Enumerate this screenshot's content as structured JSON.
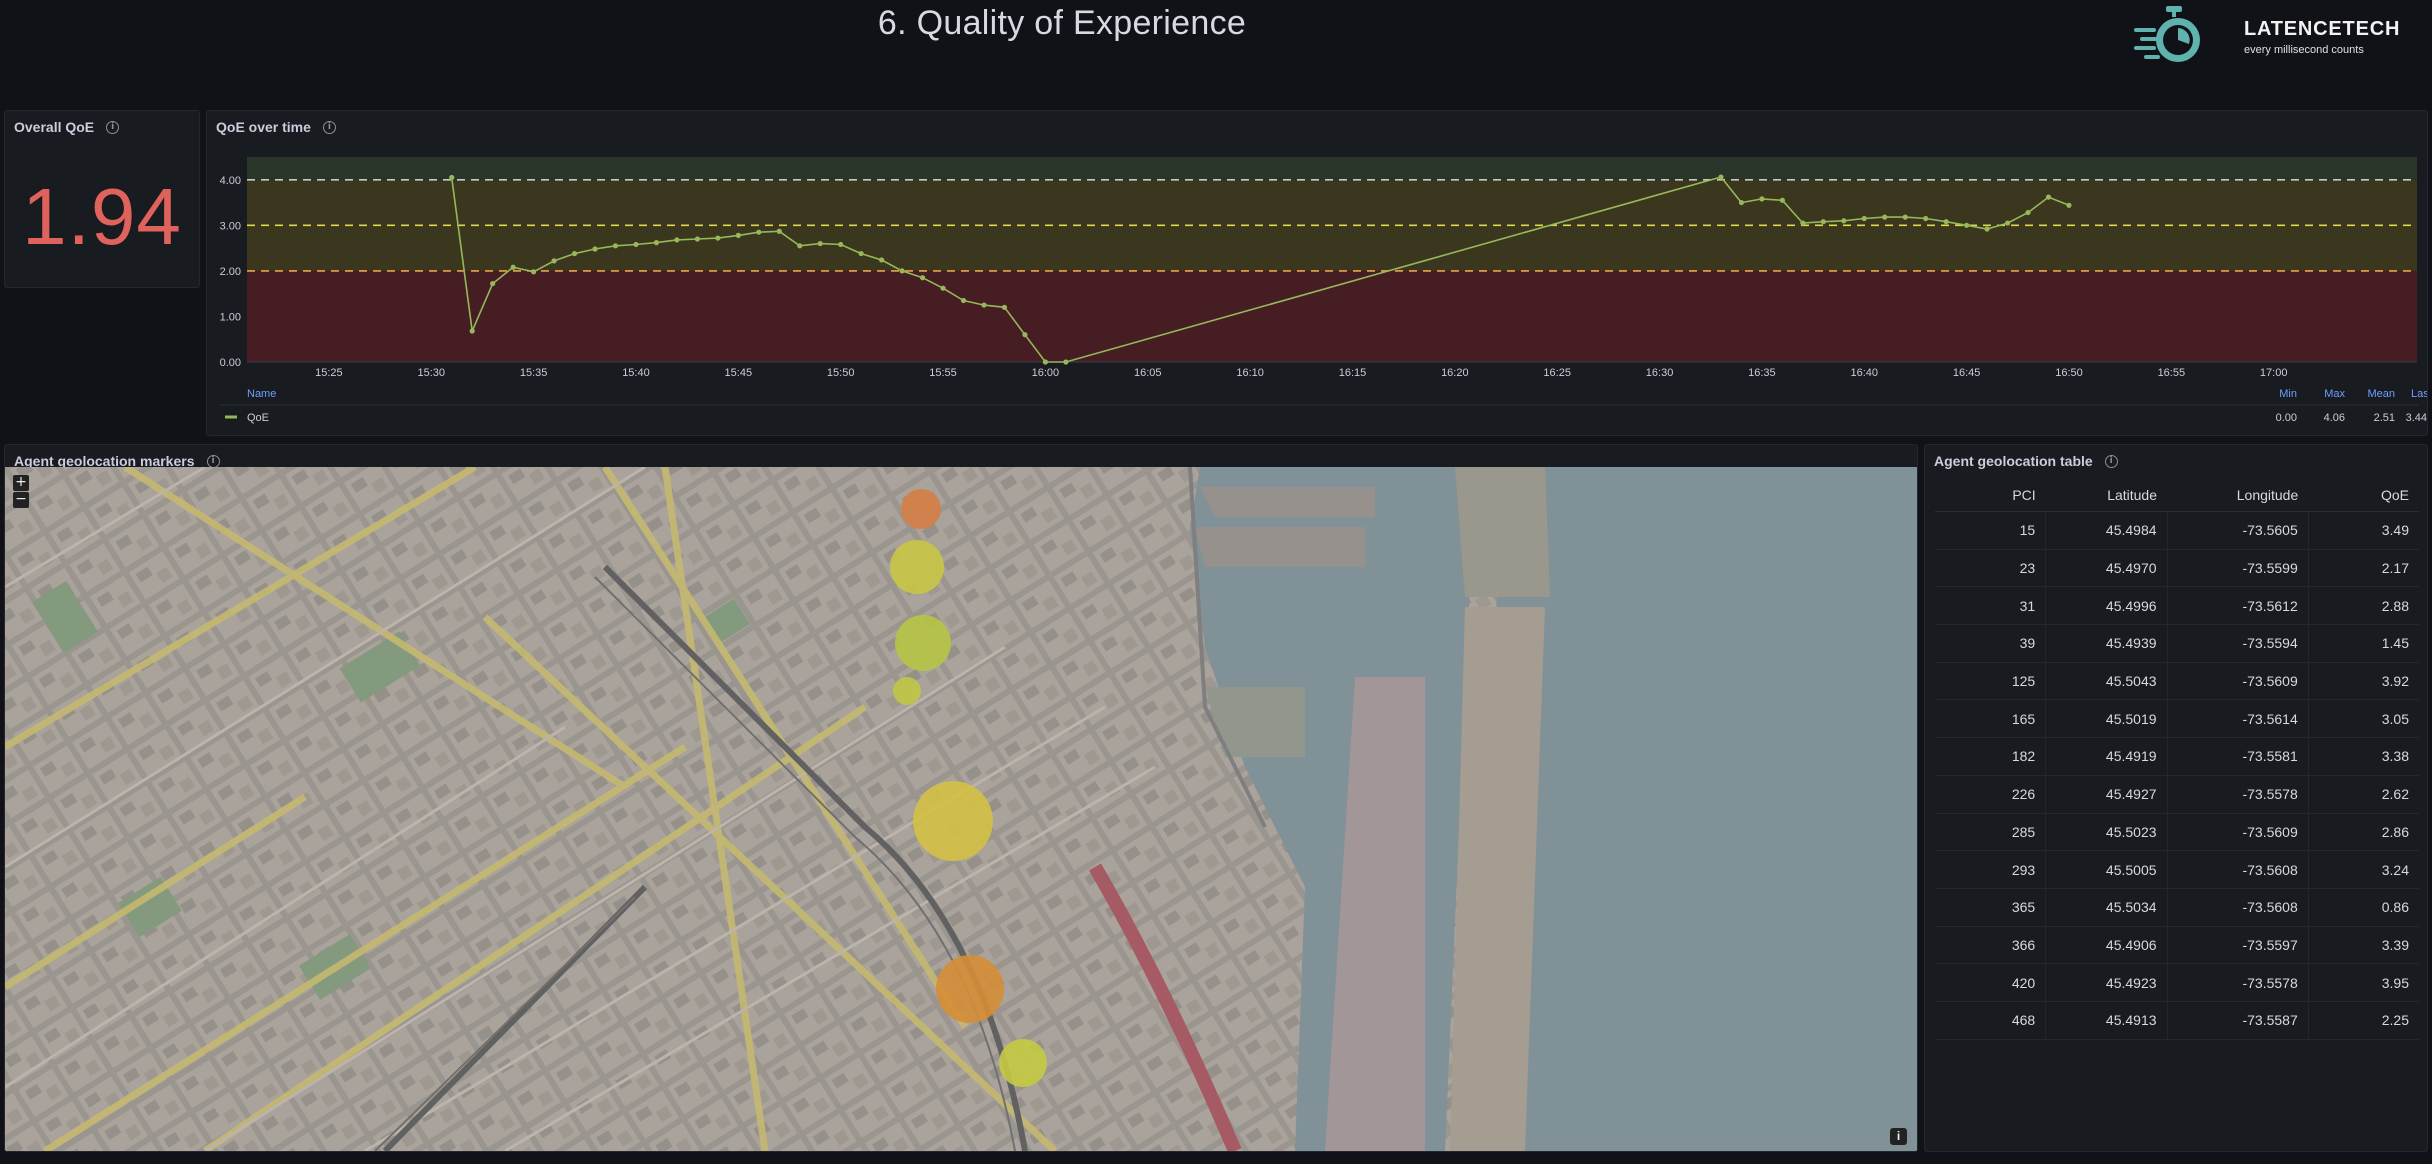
{
  "page": {
    "title": "6. Quality of Experience"
  },
  "logo": {
    "name": "LATENCETECH",
    "tagline": "every millisecond counts"
  },
  "overall_qoe": {
    "title": "Overall QoE",
    "value": "1.94",
    "color": "#e0625c"
  },
  "qoe_over_time": {
    "title": "QoE over time",
    "legend": {
      "name_header": "Name",
      "series_name": "QoE",
      "headers": {
        "min": "Min",
        "max": "Max",
        "mean": "Mean",
        "last": "Last"
      },
      "values": {
        "min": "0.00",
        "max": "4.06",
        "mean": "2.51",
        "last": "3.44"
      }
    },
    "thresholds": [
      {
        "value": 2,
        "color": "#e8a44a"
      },
      {
        "value": 3,
        "color": "#e0d84a"
      },
      {
        "value": 4,
        "color": "#c8c8c8"
      }
    ]
  },
  "chart_data": {
    "type": "line",
    "title": "QoE over time",
    "xlabel": "",
    "ylabel": "",
    "ylim": [
      0,
      4.5
    ],
    "xlim": [
      "15:21",
      "17:07"
    ],
    "y_ticks": [
      "0.00",
      "1.00",
      "2.00",
      "3.00",
      "4.00"
    ],
    "x_ticks": [
      "15:25",
      "15:30",
      "15:35",
      "15:40",
      "15:45",
      "15:50",
      "15:55",
      "16:00",
      "16:05",
      "16:10",
      "16:15",
      "16:20",
      "16:25",
      "16:30",
      "16:35",
      "16:40",
      "16:45",
      "16:50",
      "16:55",
      "17:00"
    ],
    "grid": false,
    "legend": "bottom",
    "bands": [
      {
        "from": 0,
        "to": 2,
        "color": "#4a1e24"
      },
      {
        "from": 2,
        "to": 4,
        "color": "#3f3a1e"
      },
      {
        "from": 4,
        "to": 4.5,
        "color": "#2e3a2c"
      }
    ],
    "series": [
      {
        "name": "QoE",
        "color": "#96b85a",
        "points": [
          [
            "15:31",
            4.05
          ],
          [
            "15:32",
            0.68
          ],
          [
            "15:33",
            1.72
          ],
          [
            "15:34",
            2.08
          ],
          [
            "15:35",
            1.98
          ],
          [
            "15:36",
            2.22
          ],
          [
            "15:37",
            2.38
          ],
          [
            "15:38",
            2.48
          ],
          [
            "15:39",
            2.55
          ],
          [
            "15:40",
            2.58
          ],
          [
            "15:41",
            2.62
          ],
          [
            "15:42",
            2.68
          ],
          [
            "15:43",
            2.7
          ],
          [
            "15:44",
            2.72
          ],
          [
            "15:45",
            2.78
          ],
          [
            "15:46",
            2.85
          ],
          [
            "15:47",
            2.87
          ],
          [
            "15:48",
            2.55
          ],
          [
            "15:49",
            2.6
          ],
          [
            "15:50",
            2.58
          ],
          [
            "15:51",
            2.38
          ],
          [
            "15:52",
            2.24
          ],
          [
            "15:53",
            2.0
          ],
          [
            "15:54",
            1.85
          ],
          [
            "15:55",
            1.62
          ],
          [
            "15:56",
            1.35
          ],
          [
            "15:57",
            1.25
          ],
          [
            "15:58",
            1.2
          ],
          [
            "15:59",
            0.6
          ],
          [
            "16:00",
            0.0
          ],
          [
            "16:01",
            0.0
          ],
          [
            "16:33",
            4.06
          ],
          [
            "16:34",
            3.5
          ],
          [
            "16:35",
            3.58
          ],
          [
            "16:36",
            3.55
          ],
          [
            "16:37",
            3.05
          ],
          [
            "16:38",
            3.08
          ],
          [
            "16:39",
            3.1
          ],
          [
            "16:40",
            3.15
          ],
          [
            "16:41",
            3.18
          ],
          [
            "16:42",
            3.18
          ],
          [
            "16:43",
            3.15
          ],
          [
            "16:44",
            3.08
          ],
          [
            "16:45",
            3.0
          ],
          [
            "16:46",
            2.92
          ],
          [
            "16:47",
            3.05
          ],
          [
            "16:48",
            3.28
          ],
          [
            "16:49",
            3.62
          ],
          [
            "16:50",
            3.44
          ]
        ]
      }
    ]
  },
  "geo_markers": {
    "title": "Agent geolocation markers",
    "zoom_in": "+",
    "zoom_out": "−",
    "info": "i",
    "markers": [
      {
        "qoe": 1.45,
        "color": "#e8894a"
      },
      {
        "qoe": 2.17,
        "color": "#d9d84a"
      },
      {
        "qoe": 2.62,
        "color": "#c6d64a"
      },
      {
        "qoe": 2.25,
        "color": "#d0d84a"
      },
      {
        "qoe": 2.86,
        "color": "#e6d24a"
      },
      {
        "qoe": 0.86,
        "color": "#e89a3c"
      },
      {
        "qoe": 2.88,
        "color": "#d6dc48"
      }
    ]
  },
  "geo_table": {
    "title": "Agent geolocation table",
    "headers": {
      "pci": "PCI",
      "lat": "Latitude",
      "lon": "Longitude",
      "qoe": "QoE"
    },
    "rows": [
      [
        "15",
        "45.4984",
        "-73.5605",
        "3.49"
      ],
      [
        "23",
        "45.4970",
        "-73.5599",
        "2.17"
      ],
      [
        "31",
        "45.4996",
        "-73.5612",
        "2.88"
      ],
      [
        "39",
        "45.4939",
        "-73.5594",
        "1.45"
      ],
      [
        "125",
        "45.5043",
        "-73.5609",
        "3.92"
      ],
      [
        "165",
        "45.5019",
        "-73.5614",
        "3.05"
      ],
      [
        "182",
        "45.4919",
        "-73.5581",
        "3.38"
      ],
      [
        "226",
        "45.4927",
        "-73.5578",
        "2.62"
      ],
      [
        "285",
        "45.5023",
        "-73.5609",
        "2.86"
      ],
      [
        "293",
        "45.5005",
        "-73.5608",
        "3.24"
      ],
      [
        "365",
        "45.5034",
        "-73.5608",
        "0.86"
      ],
      [
        "366",
        "45.4906",
        "-73.5597",
        "3.39"
      ],
      [
        "420",
        "45.4923",
        "-73.5578",
        "3.95"
      ],
      [
        "468",
        "45.4913",
        "-73.5587",
        "2.25"
      ]
    ]
  }
}
